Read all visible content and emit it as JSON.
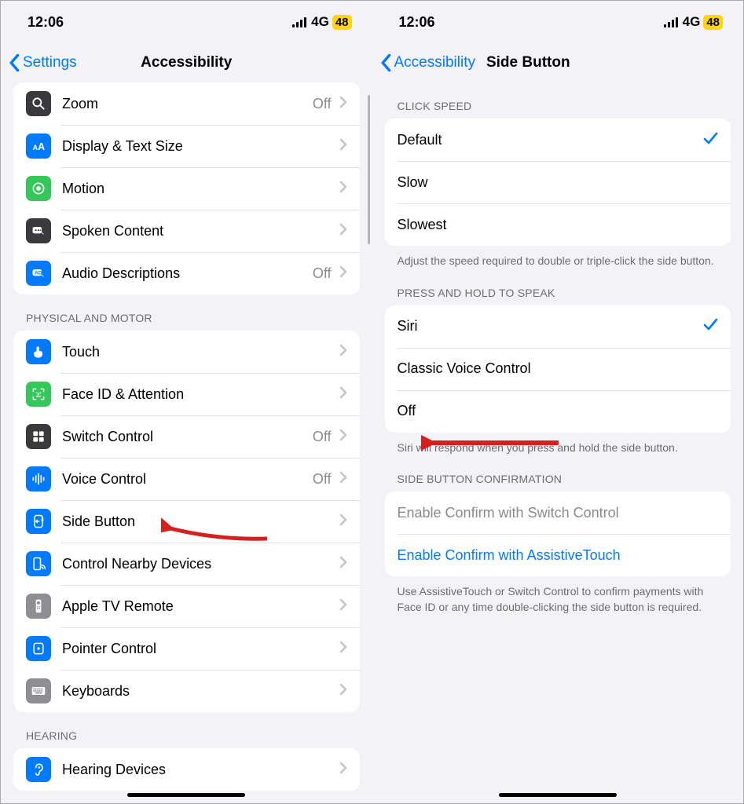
{
  "status": {
    "time": "12:06",
    "carrier": "4G",
    "battery": "48"
  },
  "left": {
    "back": "Settings",
    "title": "Accessibility",
    "section1_items": [
      {
        "label": "Zoom",
        "value": "Off",
        "icon": "zoom",
        "bg": "bg-dark"
      },
      {
        "label": "Display & Text Size",
        "value": "",
        "icon": "aa",
        "bg": "bg-blue"
      },
      {
        "label": "Motion",
        "value": "",
        "icon": "motion",
        "bg": "bg-green"
      },
      {
        "label": "Spoken Content",
        "value": "",
        "icon": "spoken",
        "bg": "bg-dark"
      },
      {
        "label": "Audio Descriptions",
        "value": "Off",
        "icon": "audiodesc",
        "bg": "bg-blue"
      }
    ],
    "section2_header": "PHYSICAL AND MOTOR",
    "section2_items": [
      {
        "label": "Touch",
        "value": "",
        "icon": "touch",
        "bg": "bg-blue"
      },
      {
        "label": "Face ID & Attention",
        "value": "",
        "icon": "faceid",
        "bg": "bg-green"
      },
      {
        "label": "Switch Control",
        "value": "Off",
        "icon": "switchctl",
        "bg": "bg-dark"
      },
      {
        "label": "Voice Control",
        "value": "Off",
        "icon": "voicectl",
        "bg": "bg-blue"
      },
      {
        "label": "Side Button",
        "value": "",
        "icon": "sidebtn",
        "bg": "bg-blue"
      },
      {
        "label": "Control Nearby Devices",
        "value": "",
        "icon": "nearby",
        "bg": "bg-blue"
      },
      {
        "label": "Apple TV Remote",
        "value": "",
        "icon": "tvremote",
        "bg": "bg-gray"
      },
      {
        "label": "Pointer Control",
        "value": "",
        "icon": "pointer",
        "bg": "bg-blue"
      },
      {
        "label": "Keyboards",
        "value": "",
        "icon": "keyboard",
        "bg": "bg-gray"
      }
    ],
    "section3_header": "HEARING",
    "section3_items": [
      {
        "label": "Hearing Devices",
        "value": "",
        "icon": "hearing",
        "bg": "bg-blue"
      }
    ]
  },
  "right": {
    "back": "Accessibility",
    "title": "Side Button",
    "sec1_header": "CLICK SPEED",
    "sec1_items": [
      {
        "label": "Default",
        "checked": true
      },
      {
        "label": "Slow",
        "checked": false
      },
      {
        "label": "Slowest",
        "checked": false
      }
    ],
    "sec1_footer": "Adjust the speed required to double or triple-click the side button.",
    "sec2_header": "PRESS AND HOLD TO SPEAK",
    "sec2_items": [
      {
        "label": "Siri",
        "checked": true
      },
      {
        "label": "Classic Voice Control",
        "checked": false
      },
      {
        "label": "Off",
        "checked": false
      }
    ],
    "sec2_footer": "Siri will respond when you press and hold the side button.",
    "sec3_header": "SIDE BUTTON CONFIRMATION",
    "sec3_items": [
      {
        "label": "Enable Confirm with Switch Control",
        "style": "disabled"
      },
      {
        "label": "Enable Confirm with AssistiveTouch",
        "style": "link"
      }
    ],
    "sec3_footer": "Use AssistiveTouch or Switch Control to confirm payments with Face ID or any time double-clicking the side button is required."
  }
}
